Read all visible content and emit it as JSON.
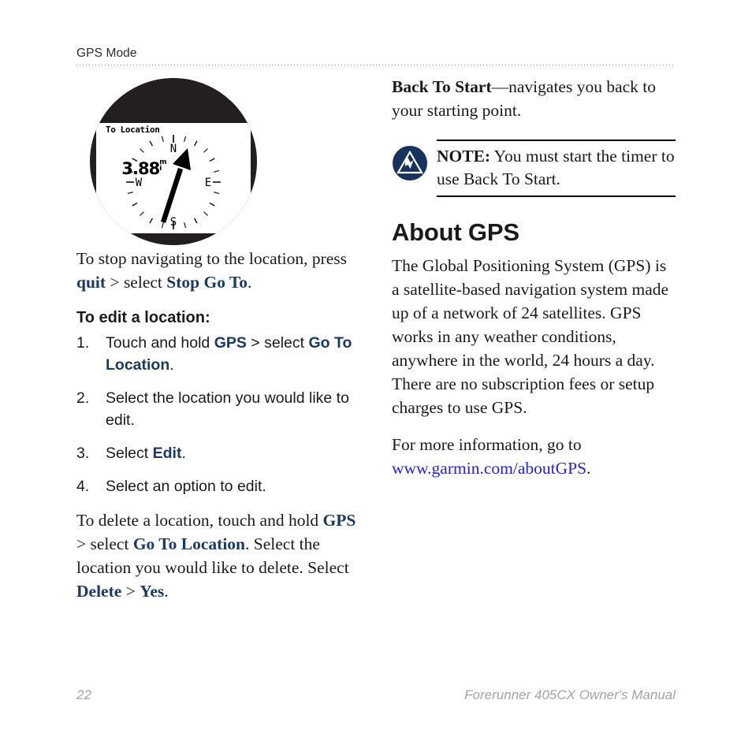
{
  "header": {
    "title": "GPS Mode"
  },
  "figure": {
    "device": "forerunner-watch",
    "screen_label": "To Location",
    "distance_value": "3.88",
    "distance_unit_top": "m",
    "distance_unit_bottom": "i",
    "compass_north": "N",
    "compass_south": "S",
    "compass_east": "E",
    "compass_west": "W",
    "bezel_color": "#231f20",
    "screen_color": "#ffffff"
  },
  "left_column": {
    "stop_nav_paragraph": {
      "part1": "To stop navigating to the location, press ",
      "ui1": "quit",
      "part2": " > select ",
      "ui2": "Stop Go To",
      "part3": "."
    },
    "edit_heading": "To edit a location:",
    "steps": [
      {
        "num": "1.",
        "part1": "Touch and hold ",
        "ui1": "GPS",
        "part2": " > select ",
        "ui2": "Go To Location",
        "part3": "."
      },
      {
        "num": "2.",
        "part1": "Select the location you would like to edit.",
        "ui1": "",
        "part2": "",
        "ui2": "",
        "part3": ""
      },
      {
        "num": "3.",
        "part1": "Select ",
        "ui1": "Edit",
        "part2": ".",
        "ui2": "",
        "part3": ""
      },
      {
        "num": "4.",
        "part1": "Select an option to edit.",
        "ui1": "",
        "part2": "",
        "ui2": "",
        "part3": ""
      }
    ],
    "delete_paragraph": {
      "part1": "To delete a location, touch and hold ",
      "ui1": "GPS",
      "part2": " > select ",
      "ui2": "Go To Location",
      "part3": ". Select the location you would like to delete. Select ",
      "ui3": "Delete",
      "part4": " > ",
      "ui4": "Yes",
      "part5": "."
    }
  },
  "right_column": {
    "back_to_start": {
      "term": "Back To Start",
      "description": "—navigates you back to your starting point."
    },
    "note": {
      "icon": "garmin-note-triangle-icon",
      "icon_color": "#17325c",
      "keyword": "NOTE:",
      "text": " You must start the timer to use Back To Start."
    },
    "about_heading": "About GPS",
    "about_paragraph": "The Global Positioning System (GPS) is a satellite-based navigation system made up of a network of 24 satellites. GPS works in any weather conditions, anywhere in the world, 24 hours a day. There are no subscription fees or setup charges to use GPS.",
    "more_info": {
      "lead": "For more information, go to ",
      "link": "www.garmin.com/aboutGPS",
      "trail": "."
    }
  },
  "footer": {
    "page_number": "22",
    "manual_title": "Forerunner 405CX Owner's Manual"
  },
  "colors": {
    "ui_term_navy": "#1b3a63",
    "link_blue": "#2323dd",
    "footer_gray": "#a3a3a8",
    "body_black": "#1a1a1a"
  }
}
